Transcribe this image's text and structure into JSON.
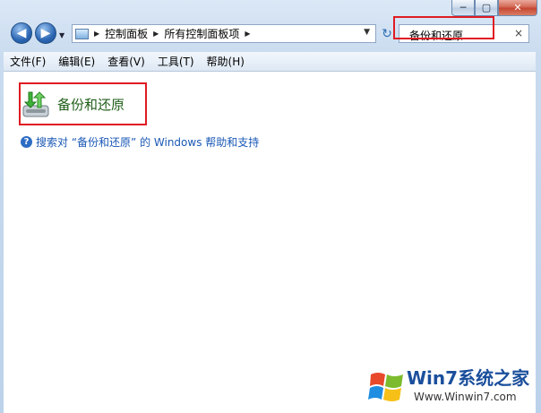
{
  "window": {
    "caption": {
      "minimize": "─",
      "maximize": "▢",
      "close": "✕"
    }
  },
  "nav": {
    "back_icon": "back-arrow-icon",
    "forward_icon": "forward-arrow-icon",
    "breadcrumb": [
      "控制面板",
      "所有控制面板项"
    ],
    "search": {
      "value": "备份和还原",
      "clear": "×"
    }
  },
  "menu": {
    "items": [
      "文件(F)",
      "编辑(E)",
      "查看(V)",
      "工具(T)",
      "帮助(H)"
    ]
  },
  "content": {
    "result_title": "备份和还原",
    "help_link": "搜索对 “备份和还原” 的 Windows 帮助和支持"
  },
  "watermark": {
    "brand": "Win7系统之家",
    "url": "Www.Winwin7.com"
  },
  "colors": {
    "highlight": "#e01b22",
    "link": "#1a58b5",
    "result_title": "#1e5e17"
  }
}
